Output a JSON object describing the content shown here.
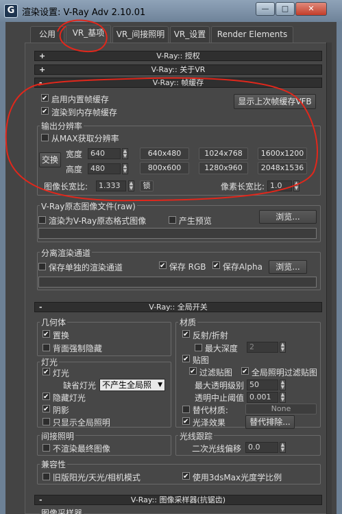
{
  "window": {
    "title": "渲染设置: V-Ray Adv 2.10.01",
    "app_icon": "G"
  },
  "tabs": [
    "公用",
    "VR_基项",
    "VR_间接照明",
    "VR_设置",
    "Render Elements"
  ],
  "rollouts": {
    "auth": "V-Ray:: 授权",
    "about": "V-Ray:: 关于VR",
    "framebuffer": "V-Ray:: 帧缓存",
    "global": "V-Ray:: 全局开关",
    "sampler": "V-Ray:: 图像采样器(抗锯齿)"
  },
  "signs": {
    "plus": "+",
    "minus": "-"
  },
  "framebuffer": {
    "enable_builtin": "启用内置帧缓存",
    "render_to_memory": "渲染到内存帧缓存",
    "show_last_vfb": "显示上次帧缓存VFB",
    "output_res_label": "输出分辨率",
    "get_from_max": "从MAX获取分辨率",
    "swap": "交换",
    "width_label": "宽度",
    "width_value": "640",
    "height_label": "高度",
    "height_value": "480",
    "presets": [
      "640x480",
      "1024x768",
      "1600x1200",
      "800x600",
      "1280x960",
      "2048x1536"
    ],
    "aspect_label": "图像长宽比:",
    "aspect_value": "1.333",
    "lock": "锁",
    "pixel_aspect_label": "像素长宽比:",
    "pixel_aspect_value": "1.0",
    "raw_group": "V-Ray原态图像文件(raw)",
    "raw_render": "渲染为V-Ray原态格式图像",
    "raw_preview": "产生预览",
    "browse": "浏览...",
    "split_group": "分离渲染通道",
    "save_split": "保存单独的渲染通道",
    "save_rgb": "保存 RGB",
    "save_alpha": "保存Alpha"
  },
  "global": {
    "geometry_label": "几何体",
    "displacement": "置换",
    "force_backface": "背面强制隐藏",
    "lights_label": "灯光",
    "lights": "灯光",
    "default_lights_label": "缺省灯光",
    "default_lights_value": "不产生全局照",
    "hidden_lights": "隐藏灯光",
    "shadows": "阴影",
    "gi_only": "只显示全局照明",
    "materials_label": "材质",
    "reflect_refract": "反射/折射",
    "max_depth_label": "最大深度",
    "max_depth_value": "2",
    "maps": "贴图",
    "filter_maps": "过滤贴图",
    "filter_maps_gi": "全局照明过滤贴图",
    "max_transp_label": "最大透明级别",
    "max_transp_value": "50",
    "transp_cutoff_label": "透明中止阈值",
    "transp_cutoff_value": "0.001",
    "override_mtl": "替代材质:",
    "override_none": "None",
    "glossy": "光泽效果",
    "override_exclude": "替代排除...",
    "indirect_label": "间接照明",
    "no_final": "不渲染最终图像",
    "raytrace_label": "光线跟踪",
    "secondary_bias_label": "二次光线偏移",
    "secondary_bias_value": "0.0",
    "compat_label": "兼容性",
    "legacy_sun": "旧版阳光/天光/相机模式",
    "use_3dsmax_photometric": "使用3dsMax光度学比例"
  },
  "sampler": {
    "group": "图像采样器"
  },
  "window_buttons": {
    "minimize": "—",
    "maximize": "□",
    "close": "✕"
  }
}
